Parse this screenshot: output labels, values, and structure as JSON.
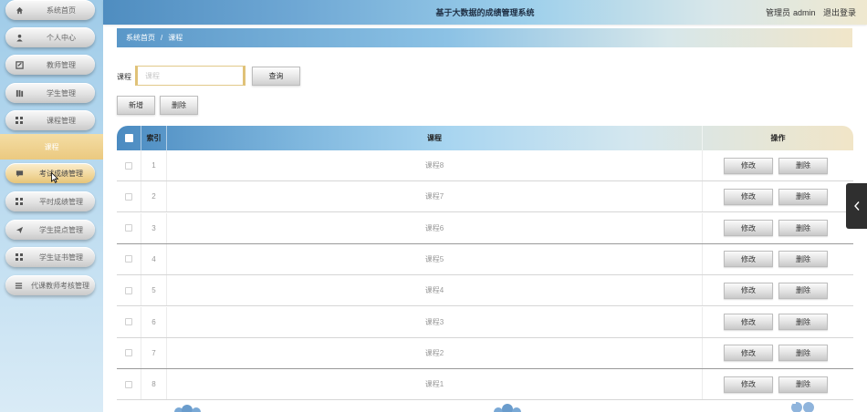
{
  "app": {
    "title": "基于大数据的成绩管理系统",
    "role_label": "管理员",
    "username": "admin",
    "logout_label": "退出登录"
  },
  "sidebar": {
    "items": [
      {
        "label": "系统首页",
        "icon": "home-icon"
      },
      {
        "label": "个人中心",
        "icon": "user-icon"
      },
      {
        "label": "教师管理",
        "icon": "edit-icon"
      },
      {
        "label": "学生管理",
        "icon": "book-icon"
      },
      {
        "label": "课程管理",
        "icon": "grid-icon"
      }
    ],
    "group_label": "课程",
    "sub_items": [
      {
        "label": "考试成绩管理",
        "icon": "comment-icon",
        "active": true
      },
      {
        "label": "平时成绩管理",
        "icon": "grid-icon"
      },
      {
        "label": "学生提点管理",
        "icon": "send-icon"
      },
      {
        "label": "学生证书管理",
        "icon": "grid-icon"
      },
      {
        "label": "代课教师考核管理",
        "icon": "list-icon"
      }
    ]
  },
  "breadcrumb": {
    "home": "系统首页",
    "separator": "/",
    "current": "课程"
  },
  "search": {
    "label": "课程",
    "placeholder": "课程",
    "button_label": "查询"
  },
  "actions": {
    "add_label": "新增",
    "delete_label": "删除"
  },
  "table": {
    "headers": {
      "index": "索引",
      "name": "课程",
      "ops": "操作"
    },
    "edit_label": "修改",
    "delete_label": "删除",
    "rows": [
      {
        "index": "1",
        "name": "课程8"
      },
      {
        "index": "2",
        "name": "课程7"
      },
      {
        "index": "3",
        "name": "课程6"
      },
      {
        "index": "4",
        "name": "课程5"
      },
      {
        "index": "5",
        "name": "课程4"
      },
      {
        "index": "6",
        "name": "课程3"
      },
      {
        "index": "7",
        "name": "课程2"
      },
      {
        "index": "8",
        "name": "课程1"
      }
    ]
  },
  "colors": {
    "sidebar_bg": "#b7d9ef",
    "accent_gold": "#ebc980",
    "header_blue": "#4f8dc0",
    "side_tab": "#2f2f2f"
  }
}
